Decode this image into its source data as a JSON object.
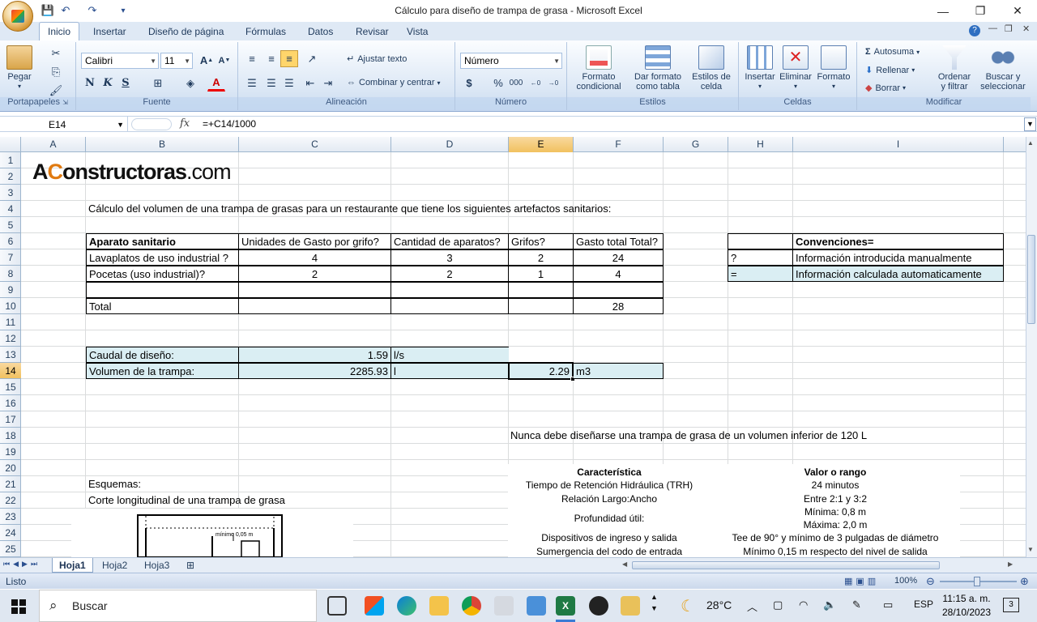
{
  "window": {
    "title": "Cálculo para diseño de trampa de grasa - Microsoft Excel",
    "minimize": "—",
    "maximize": "❐",
    "close": "✕"
  },
  "tabs": [
    "Inicio",
    "Insertar",
    "Diseño de página",
    "Fórmulas",
    "Datos",
    "Revisar",
    "Vista"
  ],
  "ribbon": {
    "paste": "Pegar",
    "clipboard_group": "Portapapeles",
    "font_name": "Calibri",
    "font_size": "11",
    "font_group": "Fuente",
    "bold": "N",
    "italic": "K",
    "underline": "S",
    "wrap_text": "Ajustar texto",
    "merge_center": "Combinar y centrar",
    "alignment_group": "Alineación",
    "number_format": "Número",
    "number_group": "Número",
    "currency": "$",
    "percent": "%",
    "thousands": "000",
    "cond_format_1": "Formato",
    "cond_format_2": "condicional",
    "table_format_1": "Dar formato",
    "table_format_2": "como tabla",
    "cell_styles_1": "Estilos de",
    "cell_styles_2": "celda",
    "styles_group": "Estilos",
    "insert": "Insertar",
    "delete": "Eliminar",
    "format": "Formato",
    "cells_group": "Celdas",
    "autosum": "Autosuma",
    "fill": "Rellenar",
    "clear": "Borrar",
    "sort_1": "Ordenar",
    "sort_2": "y filtrar",
    "find_1": "Buscar y",
    "find_2": "seleccionar",
    "editing_group": "Modificar"
  },
  "formula_bar": {
    "name_box": "E14",
    "fx": "fx",
    "formula": "=+C14/1000"
  },
  "columns": [
    "A",
    "B",
    "C",
    "D",
    "E",
    "F",
    "G",
    "H",
    "I"
  ],
  "selected_column": "E",
  "rows": [
    "1",
    "2",
    "3",
    "4",
    "5",
    "6",
    "7",
    "8",
    "9",
    "10",
    "11",
    "12",
    "13",
    "14",
    "15",
    "16",
    "17",
    "18",
    "19",
    "20",
    "21",
    "22",
    "23",
    "24",
    "25"
  ],
  "selected_row": "14",
  "sheet": {
    "logo_pre": "A",
    "logo_o": "C",
    "logo_rest": "onstructoras",
    "logo_com": ".com",
    "intro": "Cálculo del volumen de una trampa de grasas para un restaurante que tiene los siguientes artefactos sanitarios:",
    "table": {
      "headers": [
        "Aparato sanitario",
        "Unidades de Gasto por grifo?",
        "Cantidad de aparatos?",
        "Grifos?",
        "Gasto total Total?"
      ],
      "rows": [
        [
          "Lavaplatos de uso industrial ?",
          "4",
          "3",
          "2",
          "24"
        ],
        [
          "Pocetas (uso industrial)?",
          "2",
          "2",
          "1",
          "4"
        ]
      ],
      "total_label": "Total",
      "total_value": "28"
    },
    "conventions": {
      "title": "Convenciones=",
      "items": [
        {
          "symbol": "?",
          "text": "Información introducida manualmente"
        },
        {
          "symbol": "=",
          "text": "Información calculada automaticamente"
        }
      ]
    },
    "design_flow_label": "Caudal de diseño:",
    "design_flow_value": "1.59",
    "design_flow_unit": "l/s",
    "volume_label": "Volumen de la trampa:",
    "volume_l": "2285.93",
    "volume_l_unit": "l",
    "volume_m3": "2.29",
    "volume_m3_unit": "m3",
    "warning": "Nunca debe diseñarse una trampa de grasa de un volumen inferior de 120 L",
    "schemes": "Esquemas:",
    "section_title": "Corte longitudinal de una trampa de grasa",
    "sketch_label": "mínimo 0,05 m",
    "spec_table": {
      "headers": [
        "Característica",
        "Valor o rango"
      ],
      "rows": [
        [
          "Tiempo de Retención Hidráulica (TRH)",
          "24 minutos"
        ],
        [
          "Relación Largo:Ancho",
          "Entre 2:1 y 3:2"
        ],
        [
          "Profundidad útil:",
          "Mínima: 0,8 m"
        ],
        [
          "",
          "Máxima: 2,0 m"
        ],
        [
          "Dispositivos de ingreso y salida",
          "Tee de 90° y mínimo de 3 pulgadas de diámetro"
        ],
        [
          "Sumergencia del codo de entrada",
          "Mínimo 0,15 m respecto del nivel de salida"
        ]
      ]
    }
  },
  "sheets": [
    "Hoja1",
    "Hoja2",
    "Hoja3"
  ],
  "active_sheet": "Hoja1",
  "status": {
    "ready": "Listo",
    "zoom": "100%"
  },
  "taskbar": {
    "search_placeholder": "Buscar",
    "weather": "28°C",
    "language": "ESP",
    "time": "11:15 a. m.",
    "date": "28/10/2023",
    "notifications": "3"
  },
  "colors": {
    "accent": "#1e395b",
    "cell_fill": "#daeef3",
    "selected_header": "#f5c96a"
  }
}
